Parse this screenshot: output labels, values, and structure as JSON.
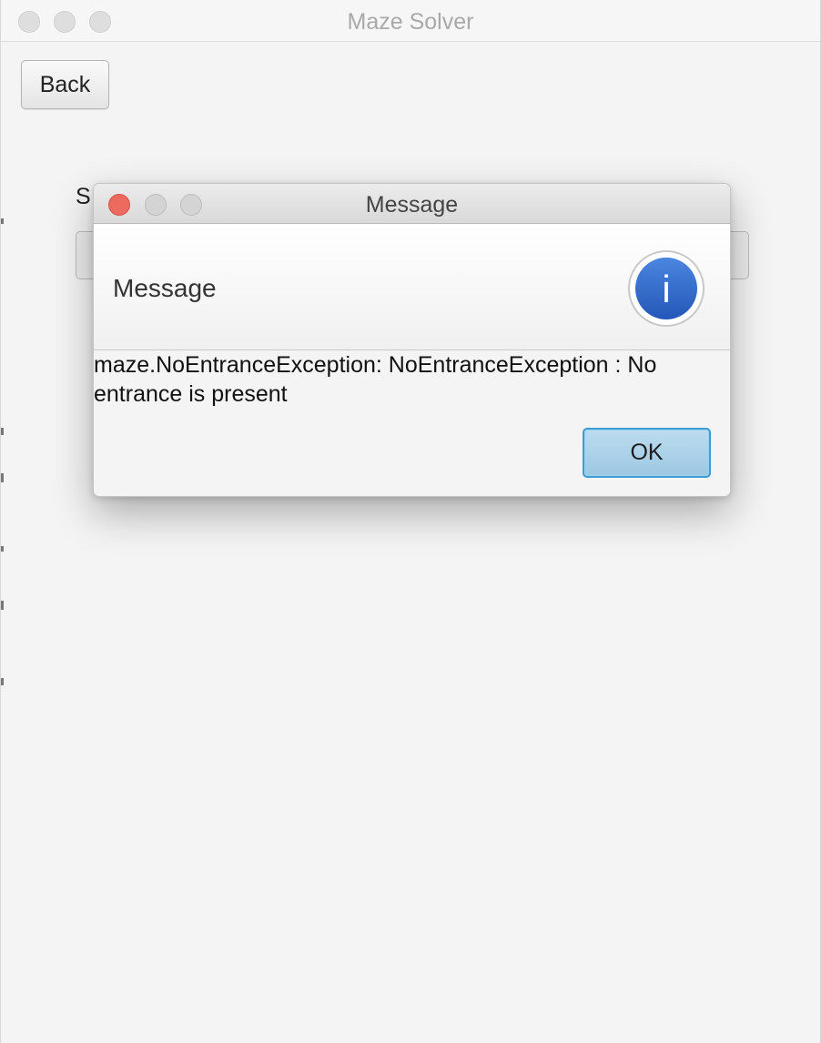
{
  "window": {
    "title": "Maze Solver",
    "back_label": "Back",
    "behind_label_fragment": "S"
  },
  "dialog": {
    "title": "Message",
    "header_text": "Message",
    "content_line1": "maze.NoEntranceException: NoEntranceException : No",
    "content_line2": "entrance is present",
    "ok_label": "OK",
    "icon": "info-icon",
    "icon_glyph": "i"
  },
  "colors": {
    "close": "#ee6a5f",
    "ok_accent": "#3f9dd1",
    "info_blue": "#2f6bd0"
  }
}
